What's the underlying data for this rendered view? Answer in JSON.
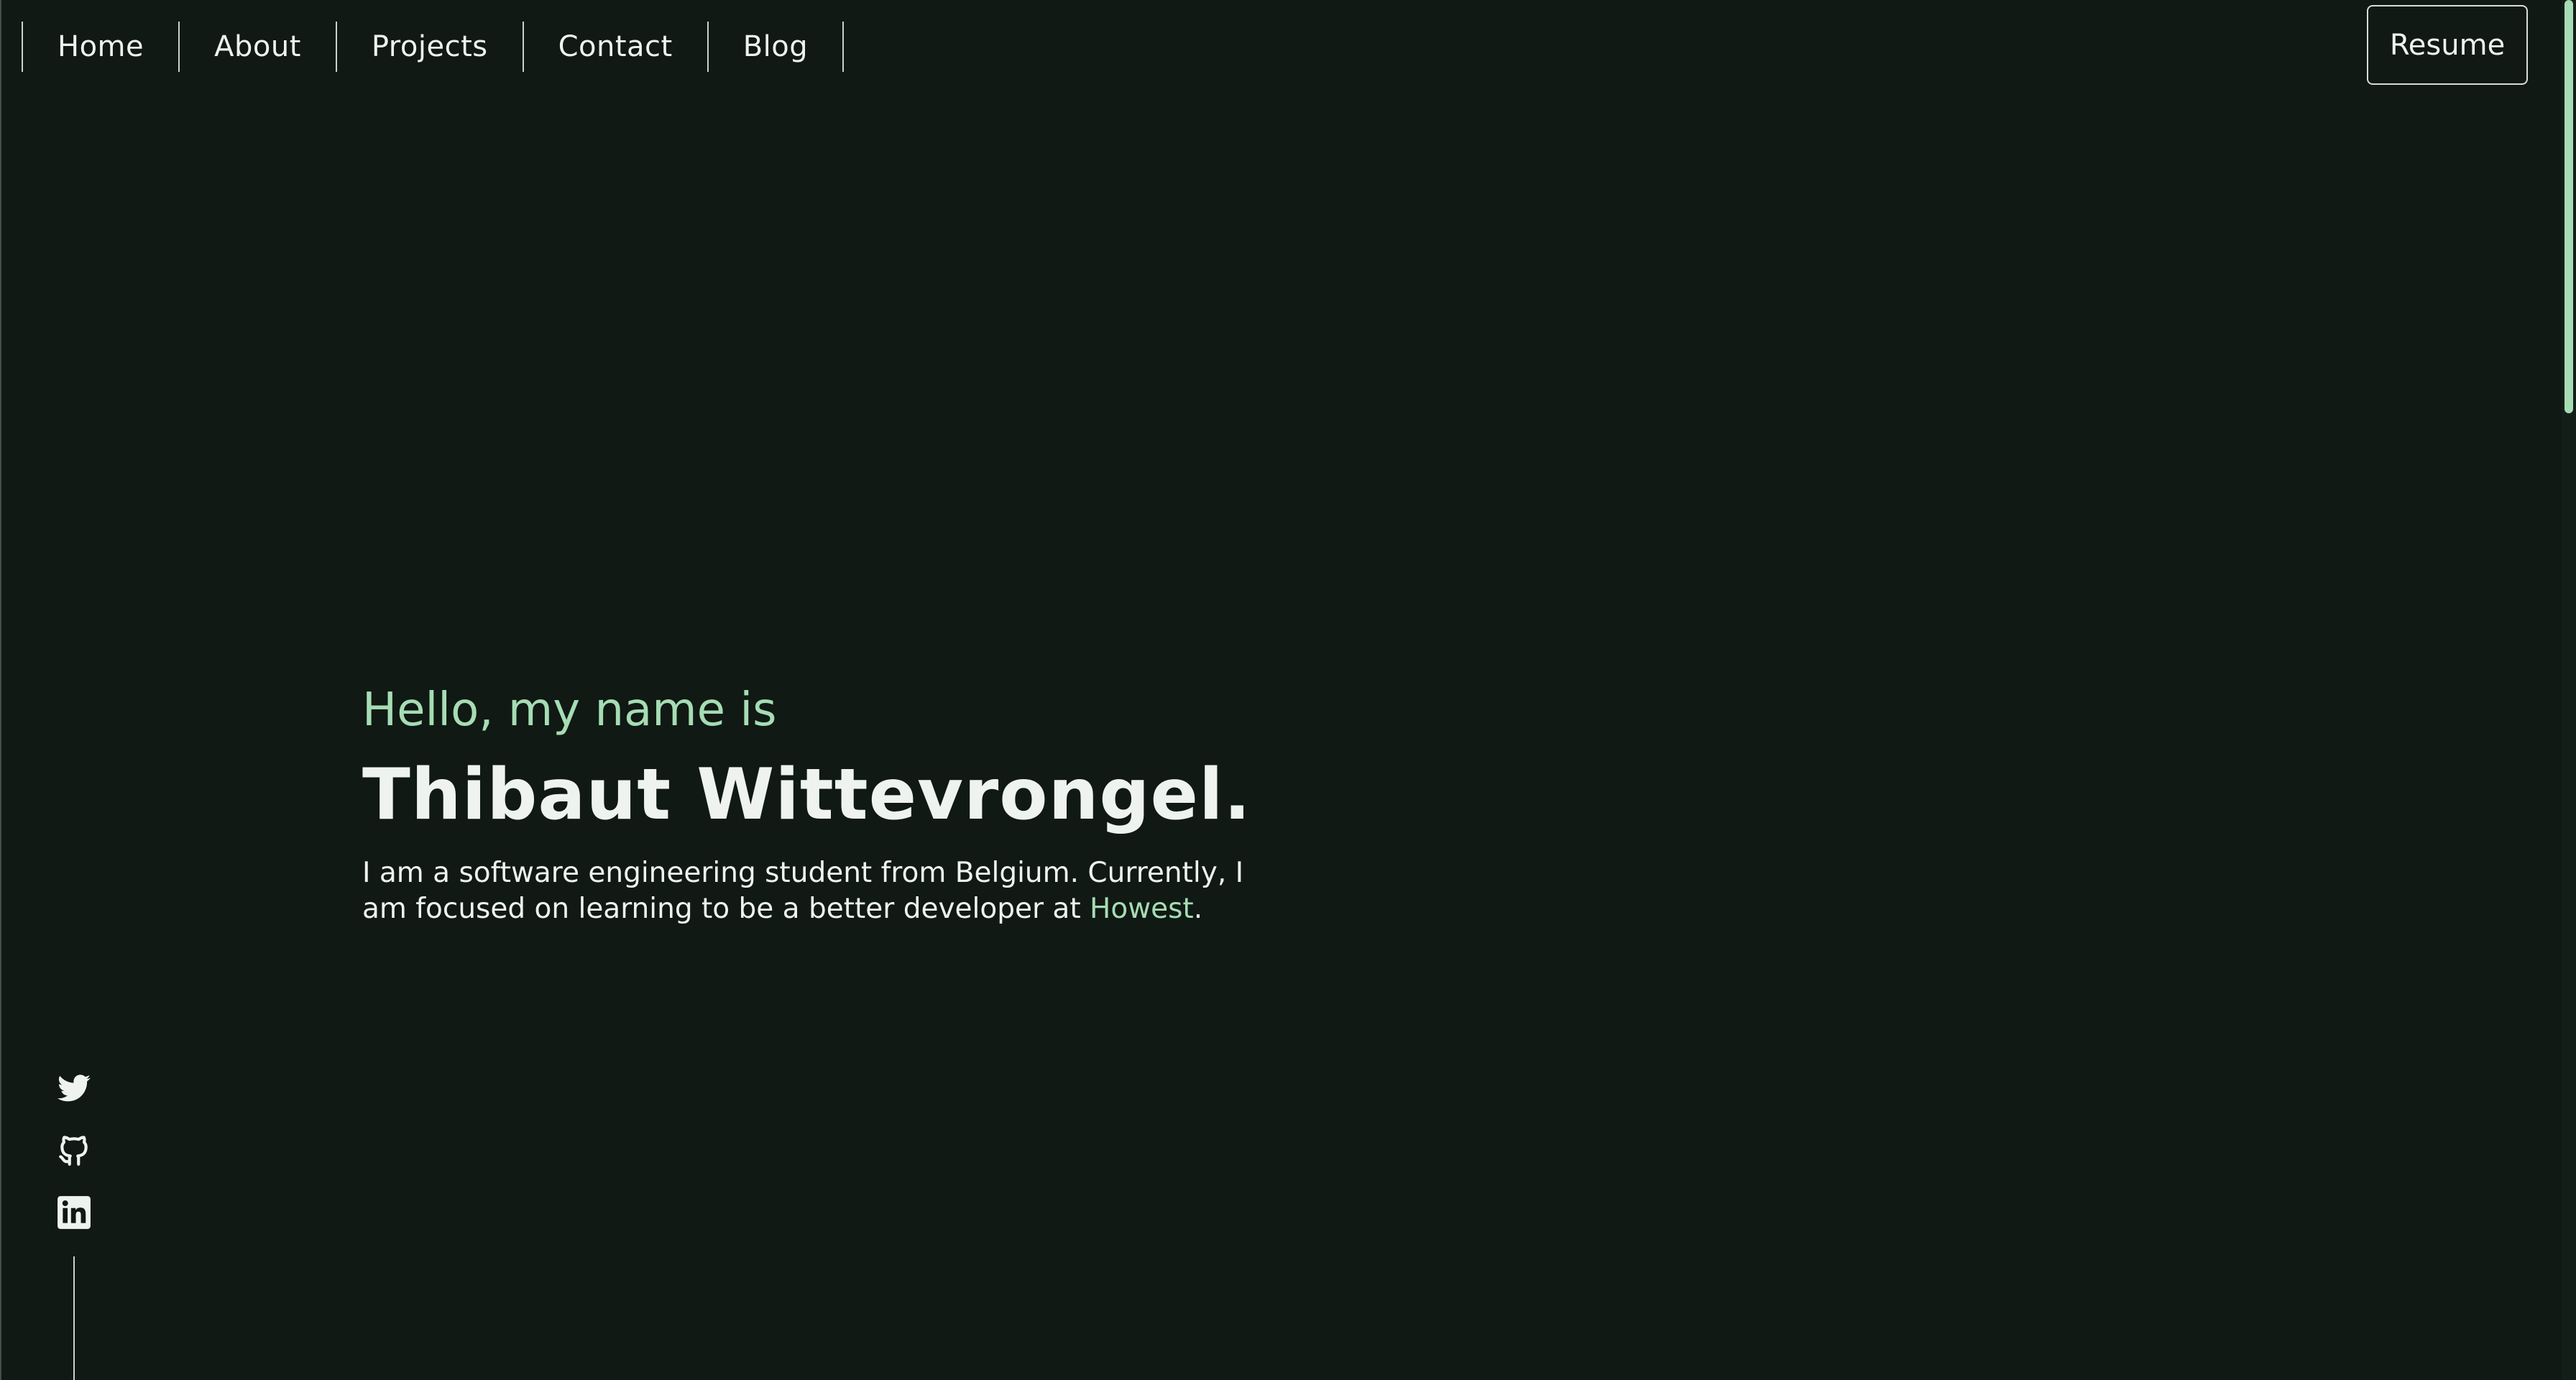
{
  "nav": {
    "items": [
      {
        "label": "Home"
      },
      {
        "label": "About"
      },
      {
        "label": "Projects"
      },
      {
        "label": "Contact"
      },
      {
        "label": "Blog"
      }
    ],
    "resume_label": "Resume"
  },
  "hero": {
    "greeting": "Hello, my name is",
    "name": "Thibaut Wittevrongel.",
    "intro_text": "I am a software engineering student from Belgium. Currently, I am focused on learning to be a better developer at ",
    "school_link": "Howest",
    "intro_end": "."
  },
  "social": {
    "icons": [
      "twitter-icon",
      "github-icon",
      "linkedin-icon"
    ]
  },
  "colors": {
    "background": "#101913",
    "accent": "#a6dcb4",
    "text": "#eef3ef"
  }
}
